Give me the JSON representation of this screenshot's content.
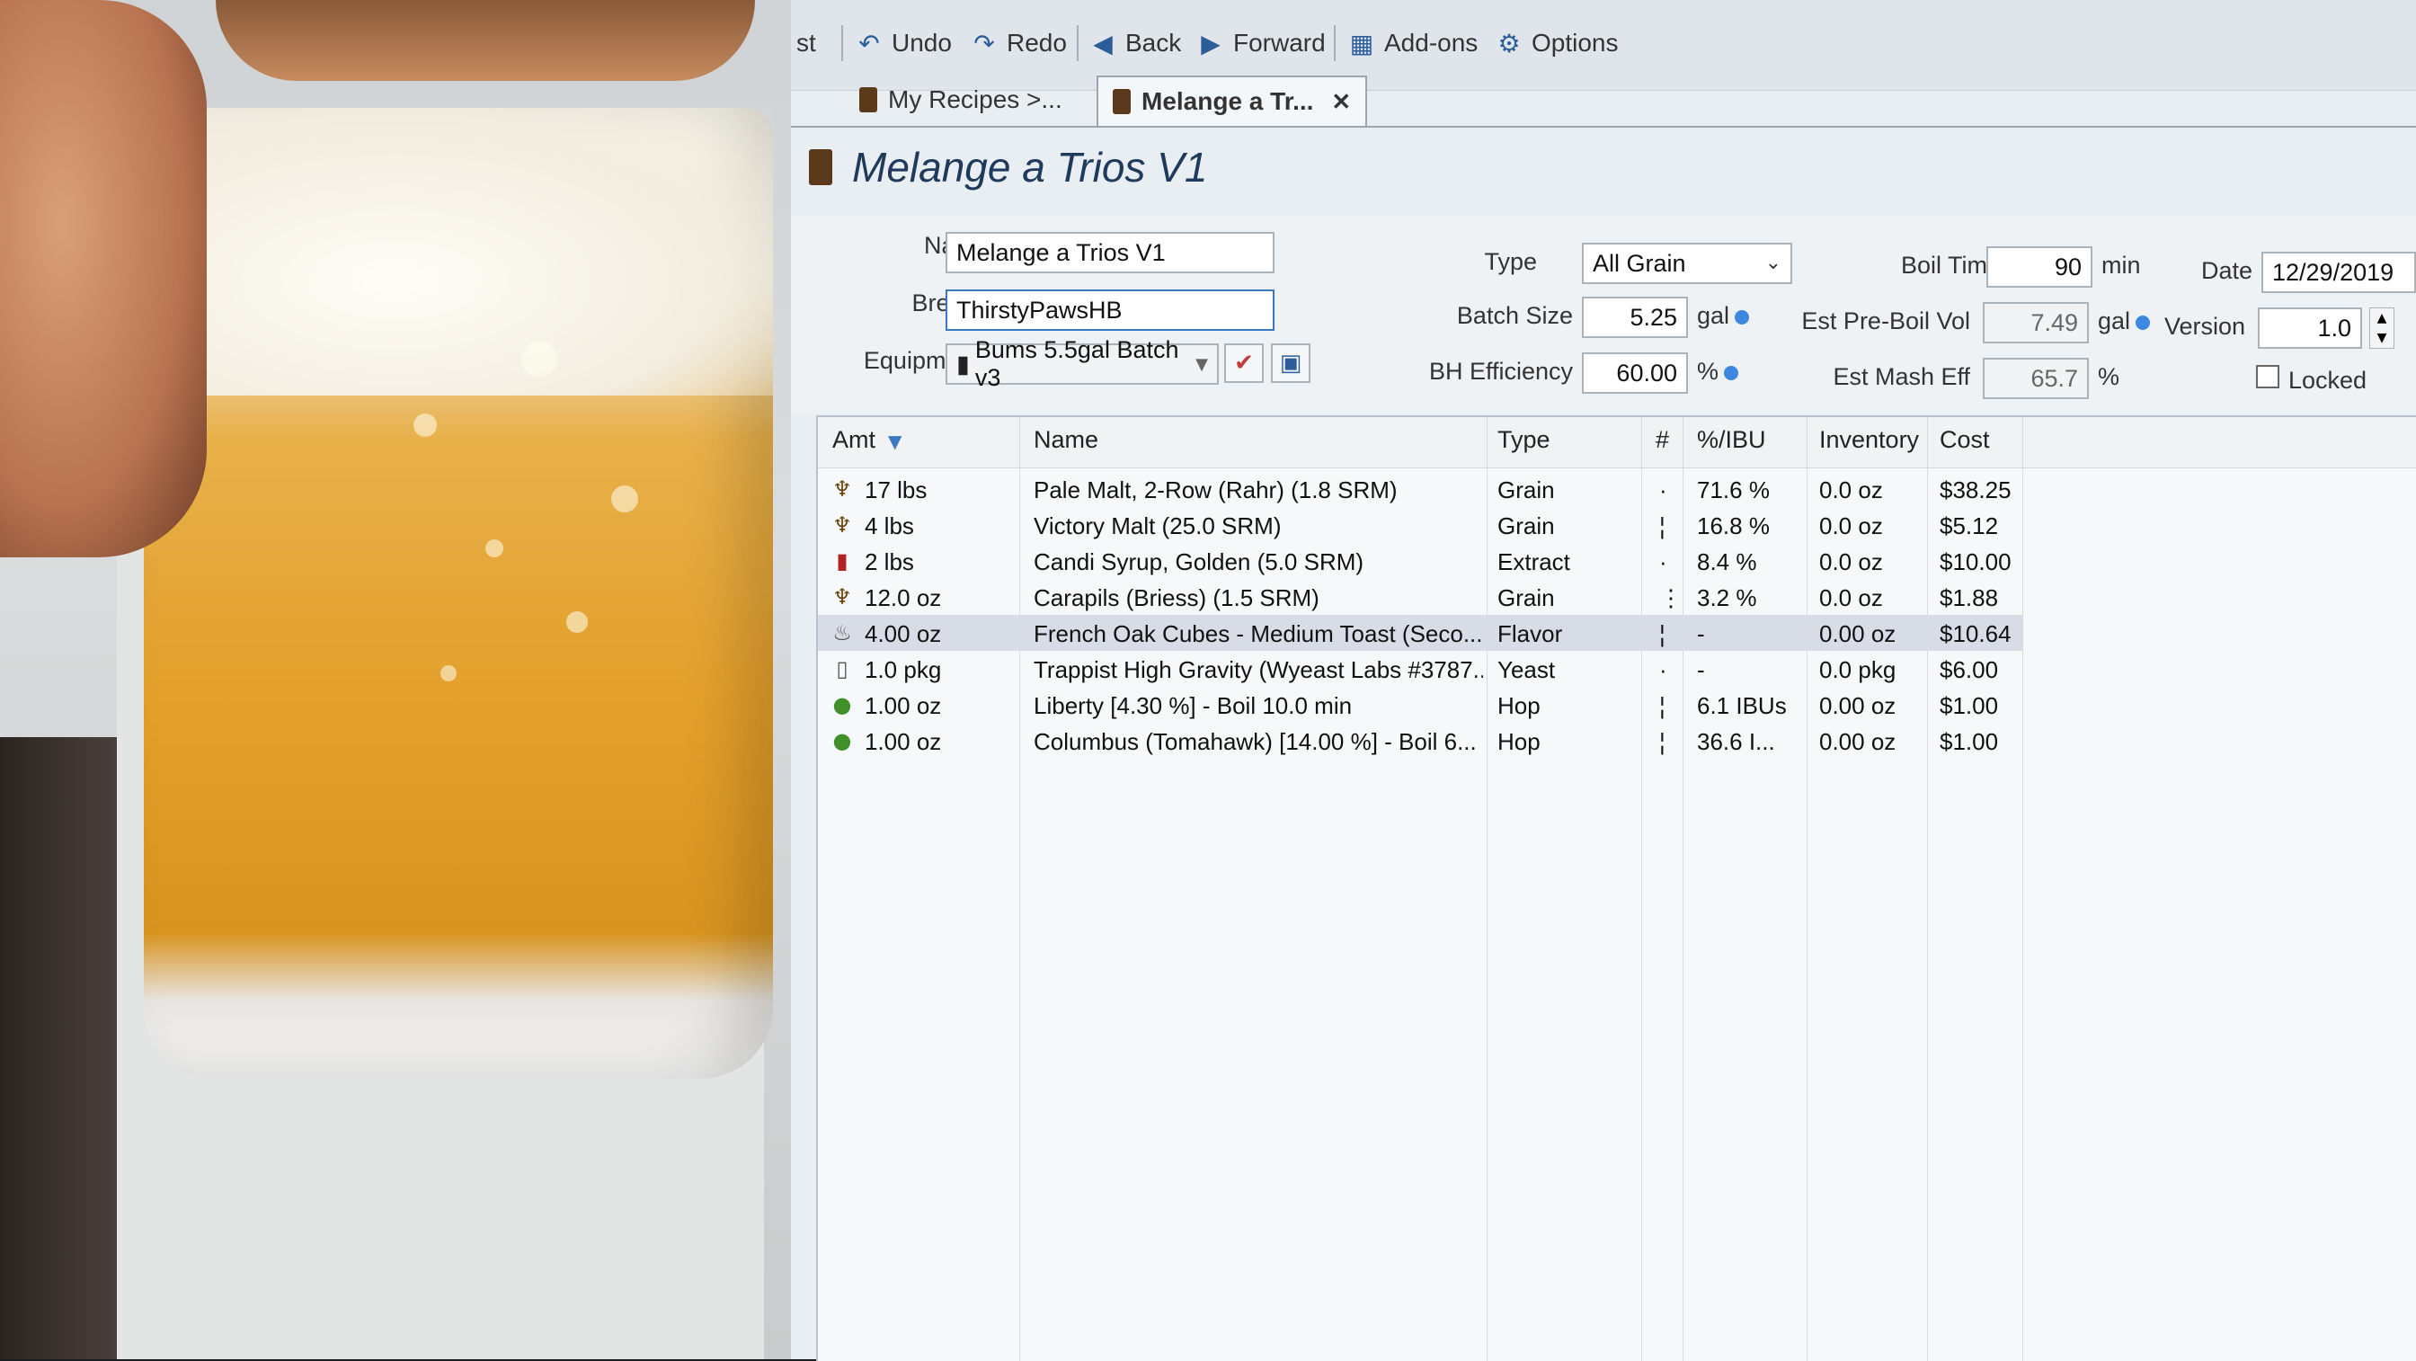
{
  "toolbar": {
    "partial_label": "st",
    "undo": "Undo",
    "redo": "Redo",
    "back": "Back",
    "forward": "Forward",
    "addons": "Add-ons",
    "options": "Options"
  },
  "tabs": [
    {
      "label": "My Recipes >..."
    },
    {
      "label": "Melange a Tr..."
    }
  ],
  "recipe_title": "Melange a Trios V1",
  "form": {
    "name_label": "Name",
    "name_value": "Melange a Trios V1",
    "brewer_label": "Brewer",
    "brewer_value": "ThirstyPawsHB",
    "equipment_label": "Equipment",
    "equipment_value": "Bums 5.5gal Batch v3",
    "type_label": "Type",
    "type_value": "All Grain",
    "batch_size_label": "Batch Size",
    "batch_size_value": "5.25",
    "batch_size_unit": "gal",
    "bh_eff_label": "BH Efficiency",
    "bh_eff_value": "60.00",
    "bh_eff_unit": "%",
    "boil_time_label": "Boil Time",
    "boil_time_value": "90",
    "boil_time_unit": "min",
    "pre_boil_label": "Est Pre-Boil Vol",
    "pre_boil_value": "7.49",
    "pre_boil_unit": "gal",
    "mash_eff_label": "Est Mash Eff",
    "mash_eff_value": "65.7",
    "mash_eff_unit": "%",
    "date_label": "Date",
    "date_value": "12/29/2019",
    "version_label": "Version",
    "version_value": "1.0",
    "locked_label": "Locked"
  },
  "grid": {
    "headers": {
      "amt": "Amt",
      "name": "Name",
      "type": "Type",
      "num": "#",
      "pct_ibu": "%/IBU",
      "inventory": "Inventory",
      "cost": "Cost"
    },
    "rows": [
      {
        "icon": "grain-icon",
        "amt": "17 lbs",
        "name": "Pale Malt, 2-Row (Rahr) (1.8 SRM)",
        "type": "Grain",
        "num": "·",
        "pct": "71.6 %",
        "inventory": "0.0 oz",
        "cost": "$38.25"
      },
      {
        "icon": "grain-icon",
        "amt": "4 lbs",
        "name": "Victory Malt (25.0 SRM)",
        "type": "Grain",
        "num": "¦",
        "pct": "16.8 %",
        "inventory": "0.0 oz",
        "cost": "$5.12"
      },
      {
        "icon": "extract-icon",
        "amt": "2 lbs",
        "name": "Candi Syrup, Golden (5.0 SRM)",
        "type": "Extract",
        "num": "·",
        "pct": "8.4 %",
        "inventory": "0.0 oz",
        "cost": "$10.00"
      },
      {
        "icon": "grain-icon",
        "amt": "12.0 oz",
        "name": "Carapils (Briess) (1.5 SRM)",
        "type": "Grain",
        "num": "⋮",
        "pct": "3.2 %",
        "inventory": "0.0 oz",
        "cost": "$1.88"
      },
      {
        "icon": "flavor-icon",
        "amt": "4.00 oz",
        "name": "French Oak Cubes - Medium Toast (Seco...",
        "type": "Flavor",
        "num": "¦",
        "pct": "-",
        "inventory": "0.00 oz",
        "cost": "$10.64"
      },
      {
        "icon": "yeast-icon",
        "amt": "1.0 pkg",
        "name": "Trappist High Gravity (Wyeast Labs #3787...",
        "type": "Yeast",
        "num": "·",
        "pct": "-",
        "inventory": "0.0 pkg",
        "cost": "$6.00"
      },
      {
        "icon": "hop-icon",
        "amt": "1.00 oz",
        "name": "Liberty [4.30 %] - Boil 10.0 min",
        "type": "Hop",
        "num": "¦",
        "pct": "6.1 IBUs",
        "inventory": "0.00 oz",
        "cost": "$1.00"
      },
      {
        "icon": "hop-icon",
        "amt": "1.00 oz",
        "name": "Columbus (Tomahawk) [14.00 %] - Boil 6...",
        "type": "Hop",
        "num": "¦",
        "pct": "36.6 I...",
        "inventory": "0.00 oz",
        "cost": "$1.00"
      }
    ]
  },
  "colors": {
    "accent": "#3a78c2",
    "selected_row": "#d8dce6",
    "title": "#1f3a5a"
  }
}
